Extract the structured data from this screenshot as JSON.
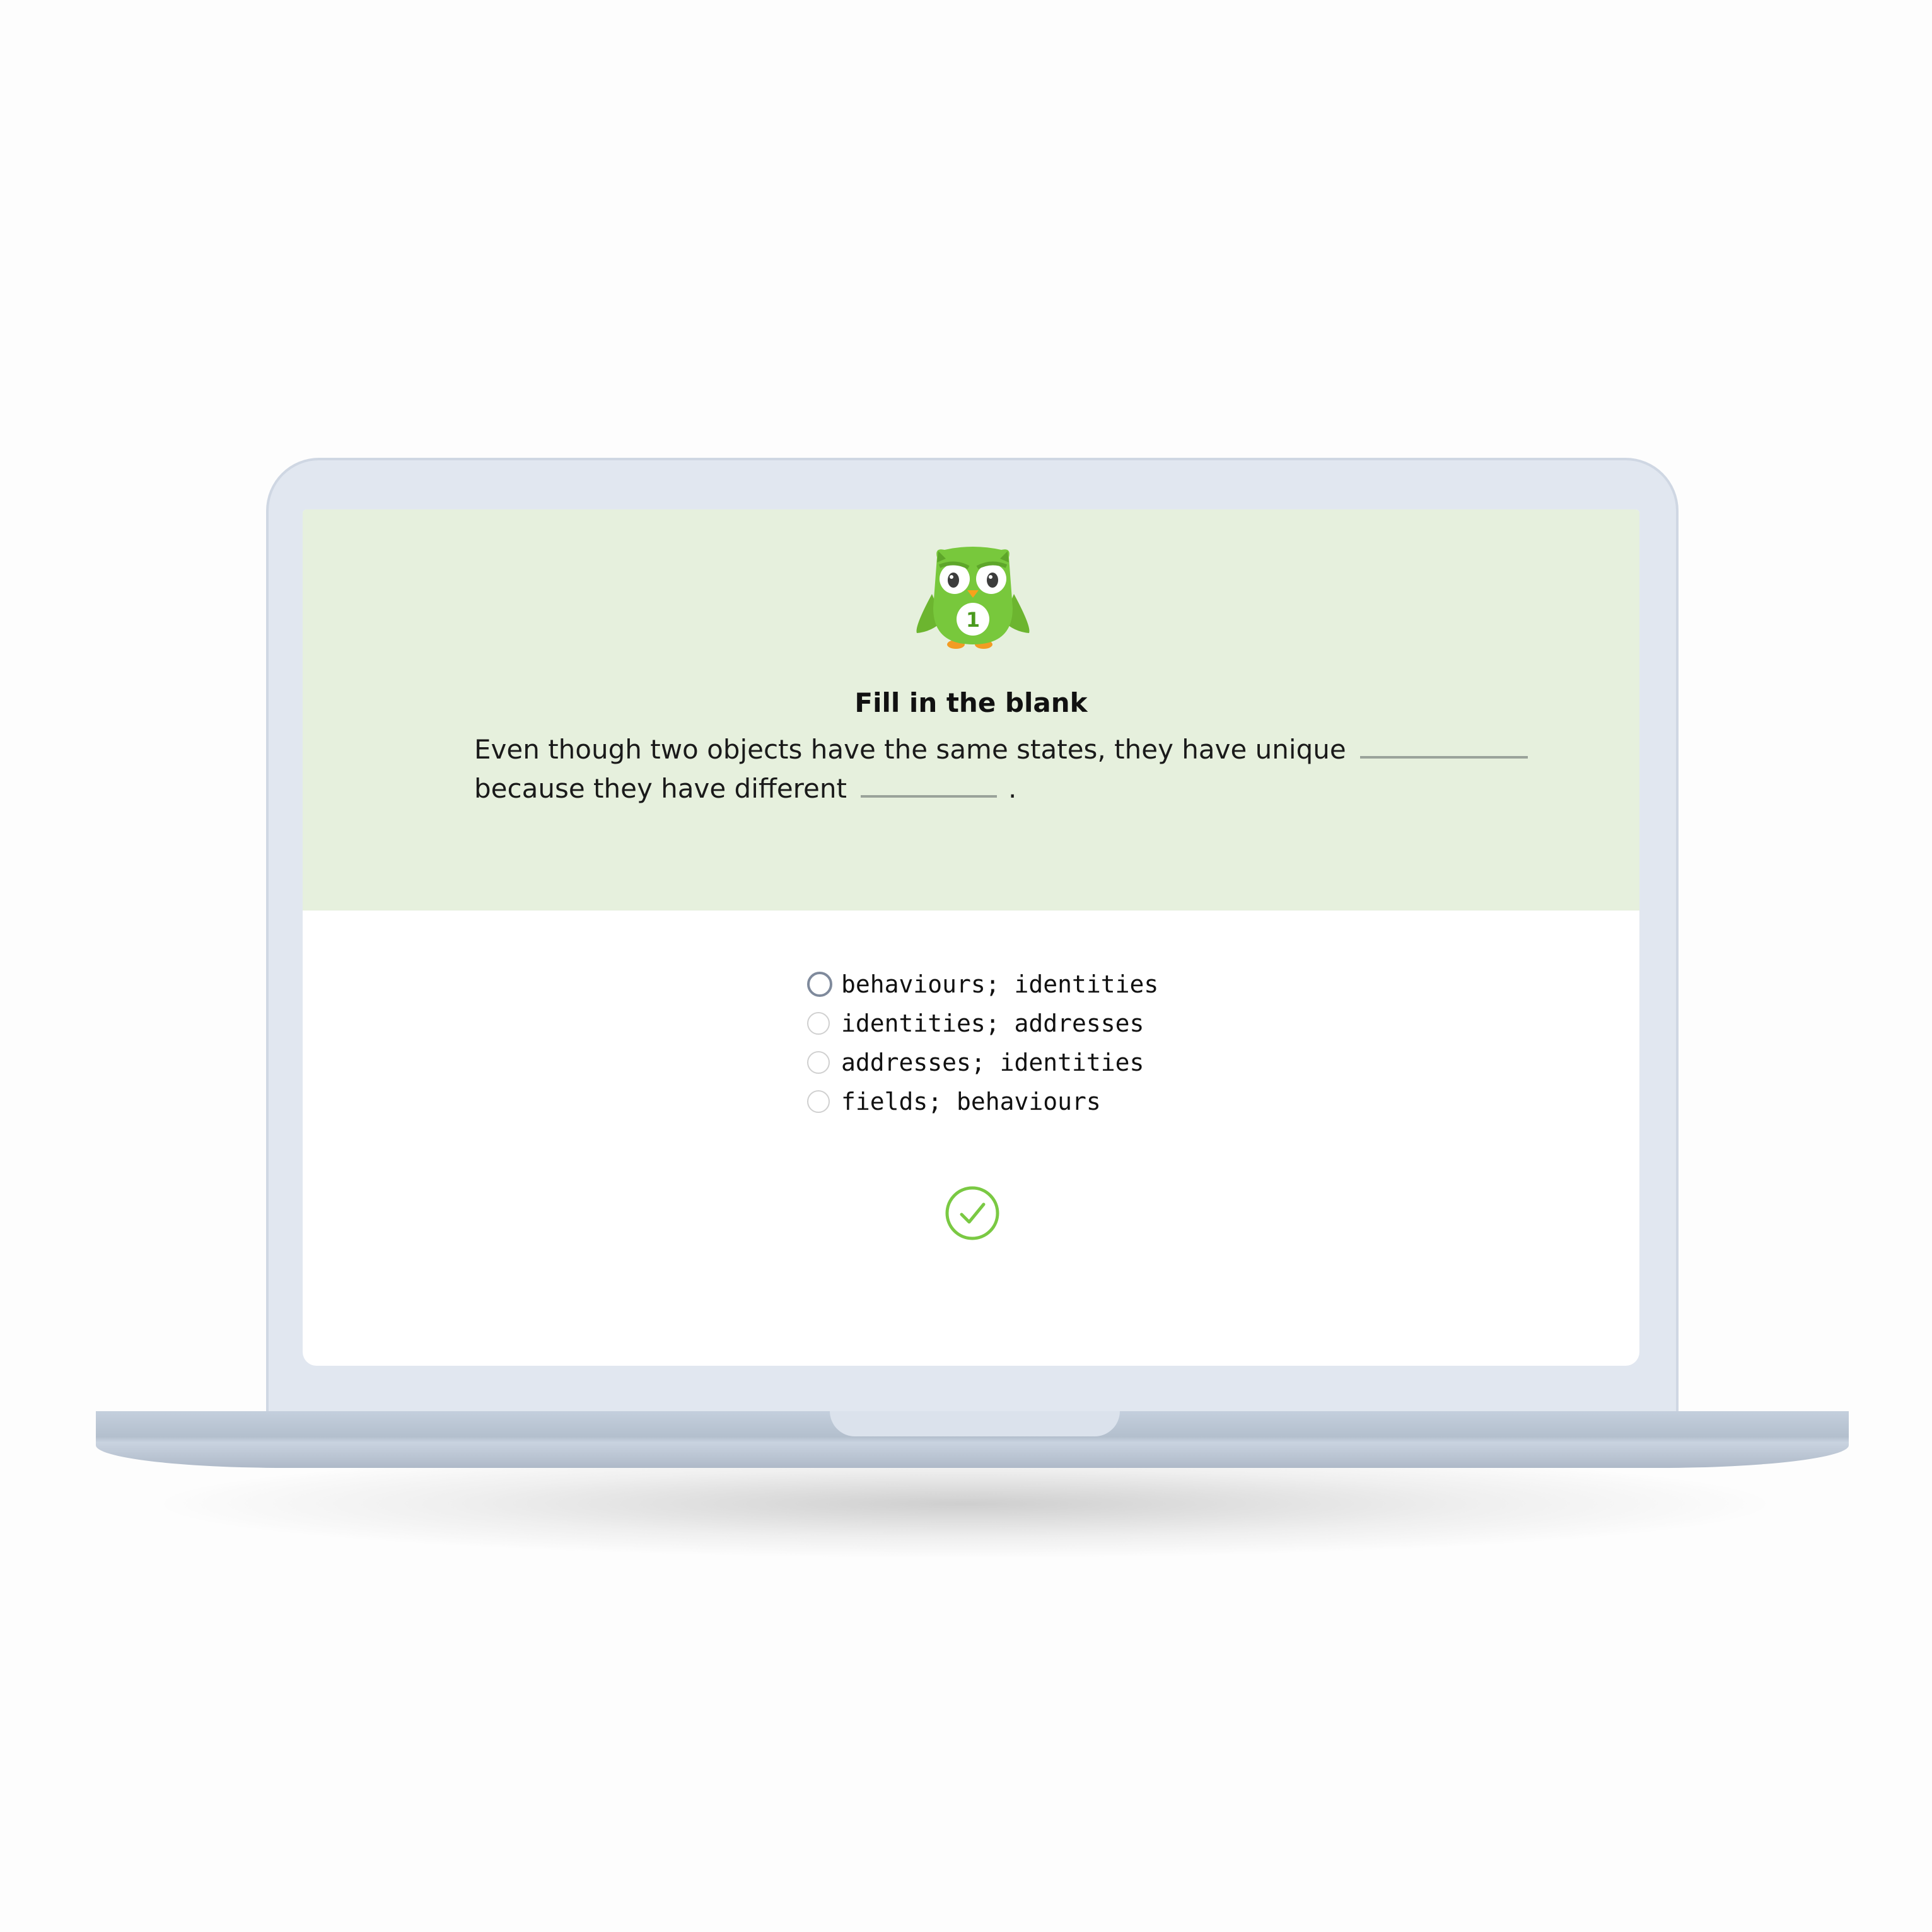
{
  "exercise": {
    "title": "Fill in the blank",
    "sentence_part1": "Even though two objects have the same states, they have unique",
    "sentence_part2": "because they have different",
    "sentence_end": ".",
    "mascot_badge_number": "1"
  },
  "options": [
    {
      "label": "behaviours; identities",
      "focused": true
    },
    {
      "label": "identities; addresses",
      "focused": false
    },
    {
      "label": "addresses; identities",
      "focused": false
    },
    {
      "label": "fields; behaviours",
      "focused": false
    }
  ],
  "icons": {
    "mascot": "owl-mascot-icon",
    "check": "check-circle-icon"
  },
  "colors": {
    "prompt_background": "#e6f0dd",
    "owl_green": "#78c83c",
    "check_green": "#7ac943",
    "device_frame": "#e1e7f0"
  }
}
